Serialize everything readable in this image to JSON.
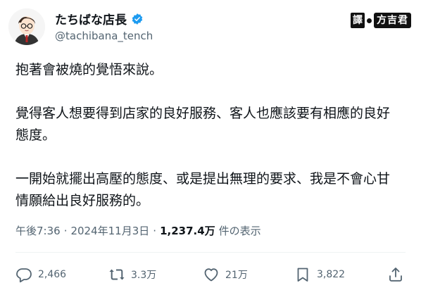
{
  "author": {
    "display_name": "たちばな店長",
    "handle": "@tachibana_tench",
    "verified": true
  },
  "watermark": {
    "label_char": "譯",
    "name": "方吉君"
  },
  "tweet": {
    "paragraphs": [
      "抱著會被燒的覺悟來說。",
      "覺得客人想要得到店家的良好服務、客人也應該要有相應的良好\n態度。",
      "一開始就擺出高壓的態度、或是提出無理的要求、我是不會心甘\n情願給出良好服務的。"
    ]
  },
  "meta": {
    "time": "午後7:36",
    "separator": "·",
    "date": "2024年11月3日",
    "views": "1,237.4万",
    "views_label": "件の表示"
  },
  "actions": {
    "reply_count": "2,466",
    "retweet_count": "3.3万",
    "like_count": "21万",
    "bookmark_count": "3,822"
  },
  "colors": {
    "text": "#0f1419",
    "secondary": "#536471",
    "verified": "#1d9bf0"
  }
}
